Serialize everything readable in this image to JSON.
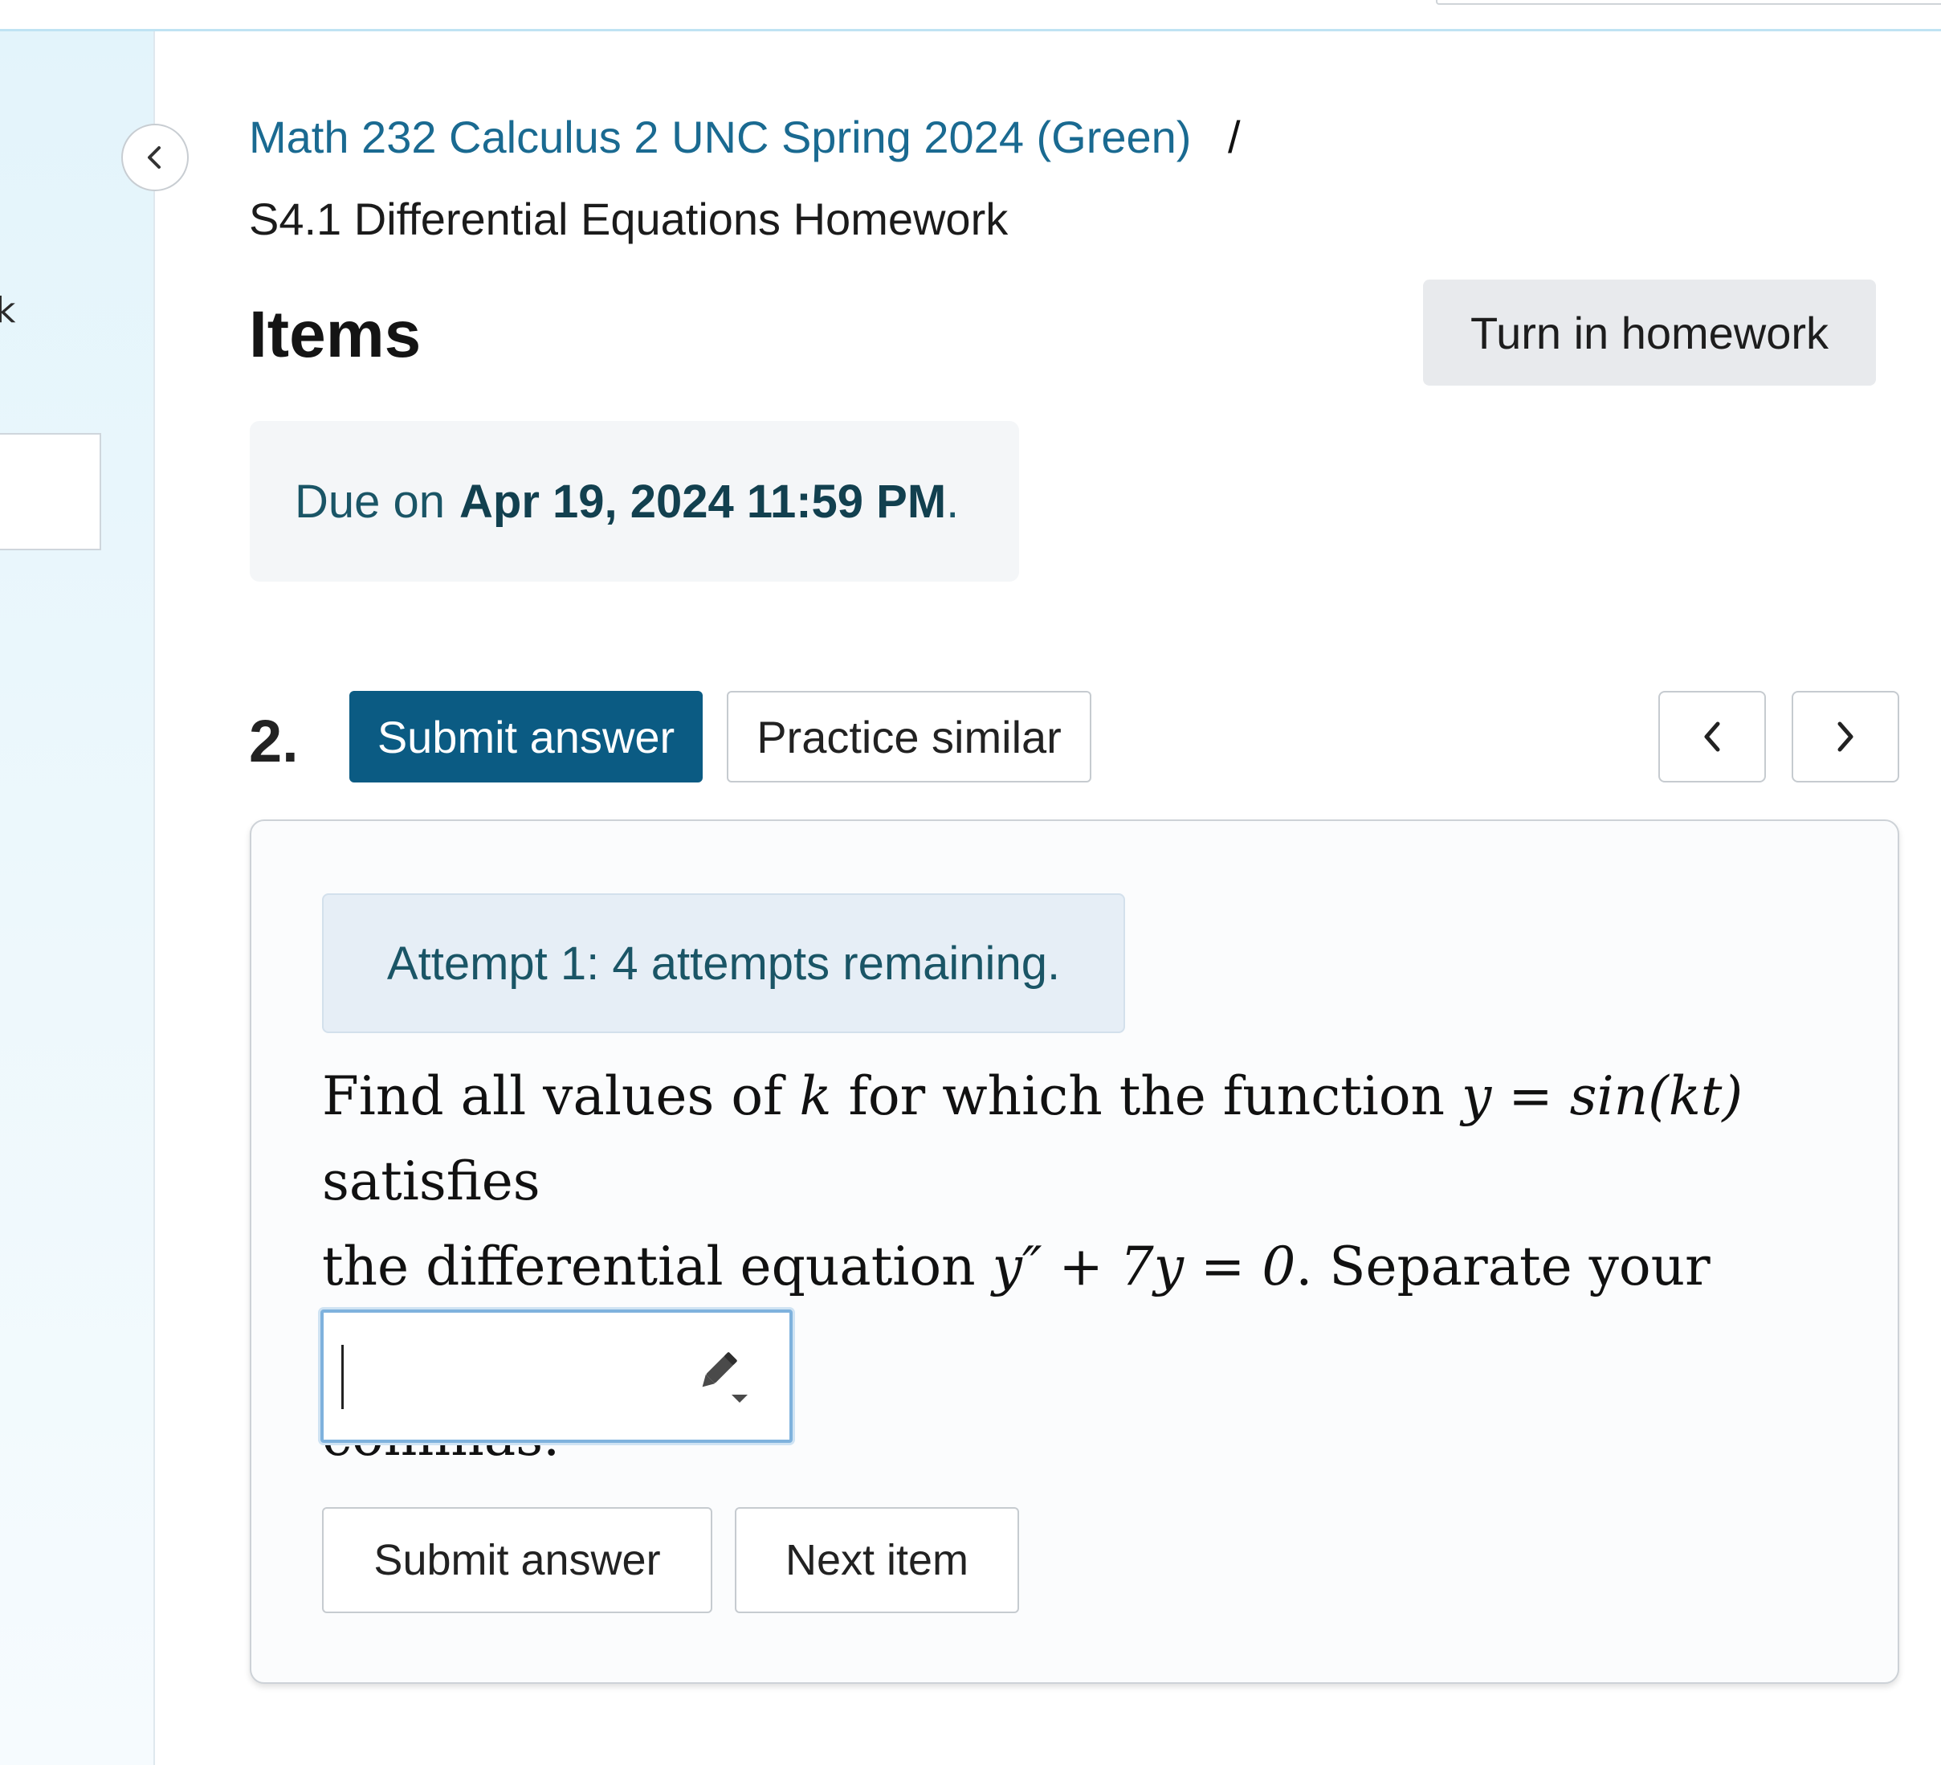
{
  "breadcrumb": {
    "course_link": "Math 232 Calculus 2 UNC Spring 2024 (Green)",
    "separator": "/",
    "current": "S4.1 Differential Equations Homework"
  },
  "sidebar": {
    "partial_glyph": "k"
  },
  "header": {
    "title": "Items",
    "turn_in_label": "Turn in homework"
  },
  "due": {
    "prefix": "Due on",
    "date": "Apr 19, 2024 11:59 PM",
    "suffix": "."
  },
  "item": {
    "number": "2.",
    "submit_label": "Submit answer",
    "practice_label": "Practice similar",
    "prev_icon": "chevron-left-icon",
    "next_icon": "chevron-right-icon"
  },
  "question": {
    "attempt_text": "Attempt 1: 4 attempts remaining.",
    "line1_a": "Find all values of ",
    "var_k": "k",
    "line1_b": " for which the function ",
    "eq_fn": "y = sin(kt)",
    "line1_c": " satisfies",
    "line2_a": "the differential equation ",
    "eq_de": "y″ + 7y = 0",
    "line2_b": ". Separate your answers by",
    "line3": "commas.",
    "answer_value": "",
    "input_icon": "pencil-icon",
    "submit_label": "Submit answer",
    "next_label": "Next item"
  },
  "colors": {
    "link": "#1a6a91",
    "primary_button": "#0b5b83",
    "due_text": "#1a5566"
  }
}
